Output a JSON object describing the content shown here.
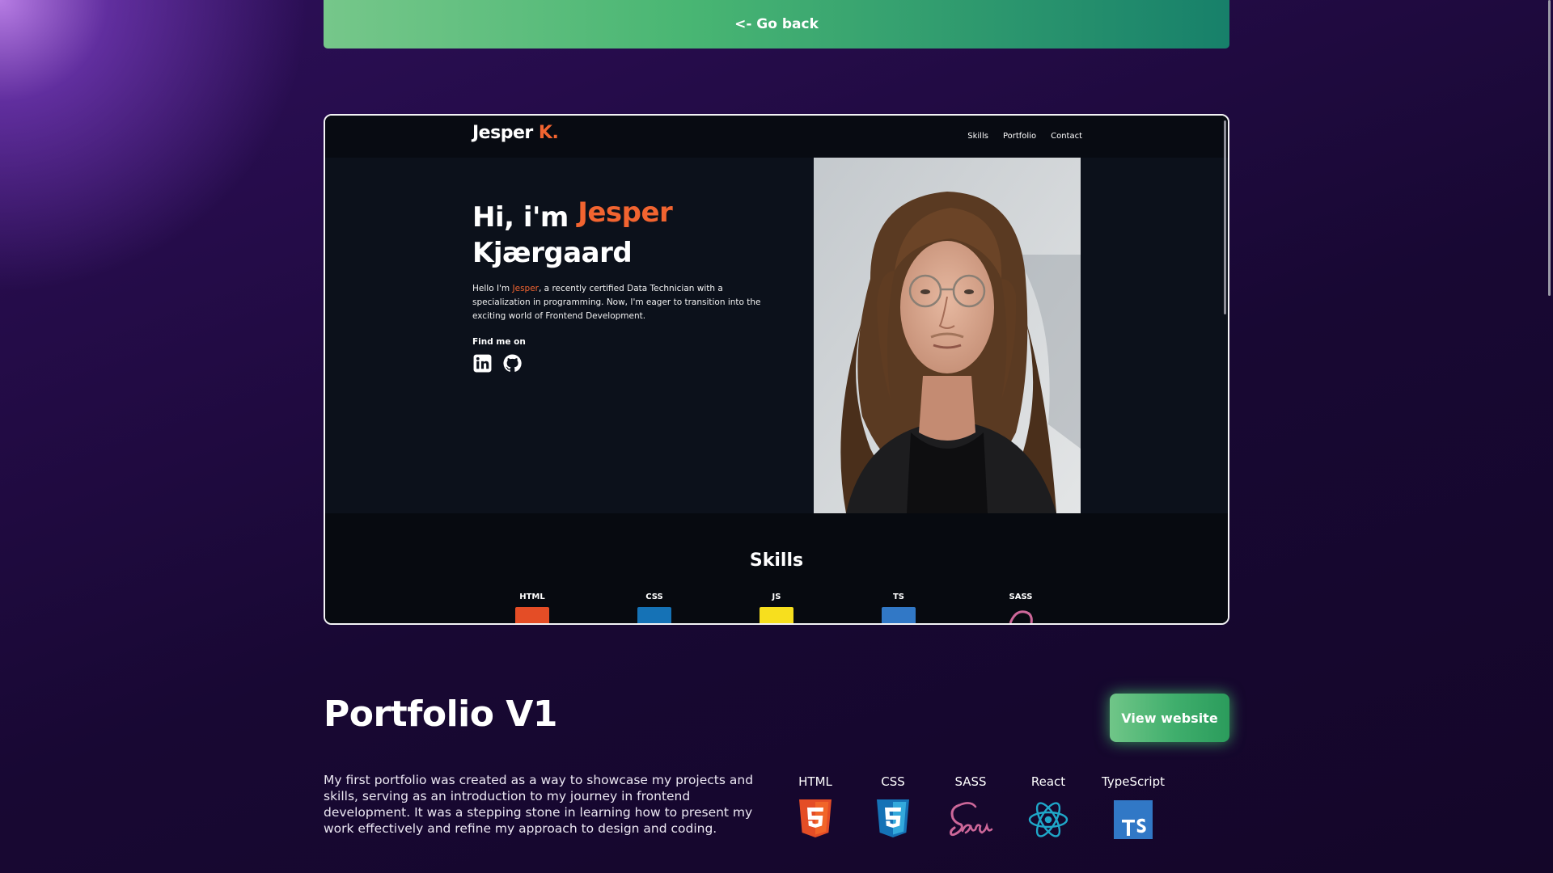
{
  "header": {
    "go_back_label": "<- Go back"
  },
  "preview": {
    "logo_name": "Jesper",
    "logo_accent": "K.",
    "nav_links": [
      "Skills",
      "Portfolio",
      "Contact"
    ],
    "hero": {
      "greeting": "Hi, i'm",
      "first_name": "Jesper",
      "last_name": "Kjærgaard",
      "desc_before": "Hello I'm ",
      "desc_name": "Jesper",
      "desc_after": ", a recently certified Data Technician with a specialization in programming. Now, I'm eager to transition into the exciting world of Frontend Development.",
      "find_me_label": "Find me on",
      "socials": [
        "linkedin-icon",
        "github-icon"
      ]
    },
    "skills": {
      "title": "Skills",
      "items": [
        {
          "label": "HTML",
          "color": "#e44d26"
        },
        {
          "label": "CSS",
          "color": "#1572b6"
        },
        {
          "label": "JS",
          "color": "#f7df1e"
        },
        {
          "label": "TS",
          "color": "#3178c6"
        },
        {
          "label": "SASS",
          "color": "#cd6799"
        }
      ]
    }
  },
  "project": {
    "title": "Portfolio V1",
    "view_button_label": "View website",
    "description": "My first portfolio was created as a way to showcase my projects and skills, serving as an introduction to my journey in frontend development. It was a stepping stone in learning how to present my work effectively and refine my approach to design and coding.",
    "technologies": [
      {
        "name": "HTML",
        "icon": "html5-icon",
        "color": "#e44d26"
      },
      {
        "name": "CSS",
        "icon": "css3-icon",
        "color": "#1572b6"
      },
      {
        "name": "SASS",
        "icon": "sass-icon",
        "color": "#cd6799"
      },
      {
        "name": "React",
        "icon": "react-icon",
        "color": "#61dafb"
      },
      {
        "name": "TypeScript",
        "icon": "typescript-icon",
        "color": "#3178c6"
      }
    ]
  },
  "colors": {
    "accent_orange": "#f26430",
    "button_green": "#3fae6c"
  }
}
